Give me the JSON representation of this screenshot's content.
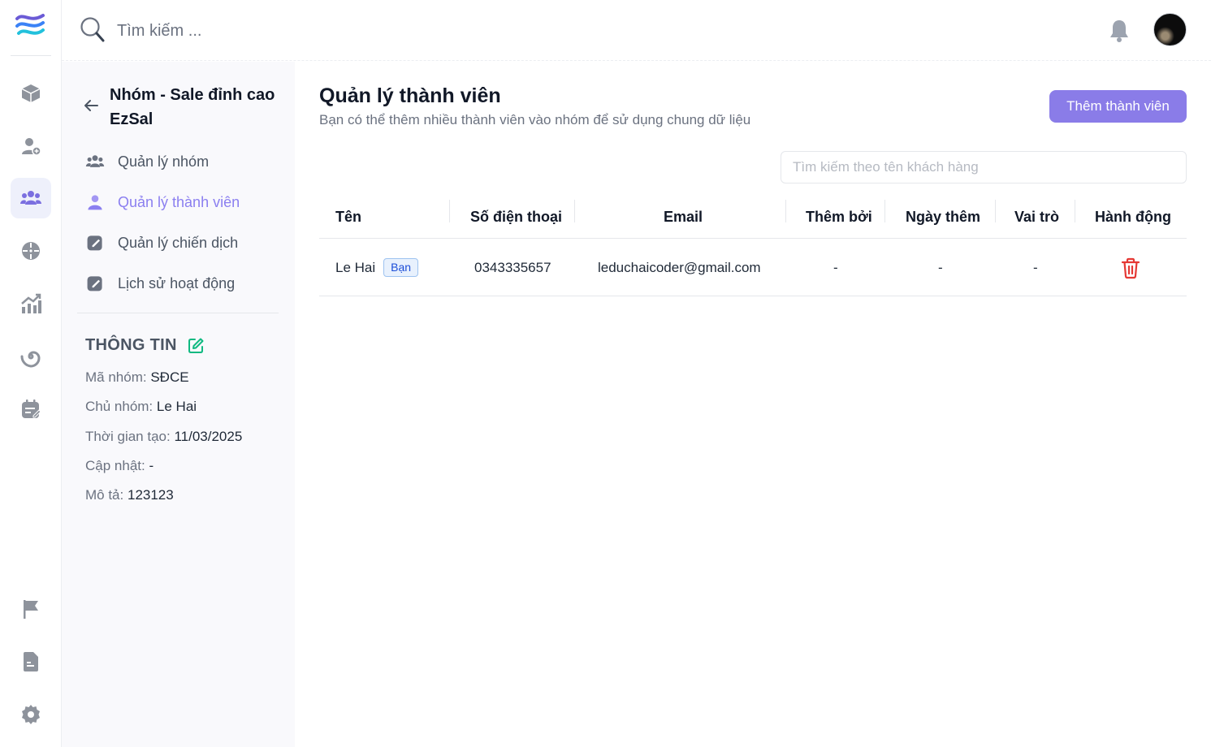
{
  "topbar": {
    "search_placeholder": "Tìm kiếm ..."
  },
  "rail": {
    "items": [
      "cube-icon",
      "user-add-icon",
      "users-icon",
      "crosshair-icon",
      "chart-icon",
      "spiral-icon",
      "calendar-edit-icon",
      "flag-icon",
      "document-icon",
      "gear-icon"
    ],
    "active": "users-icon"
  },
  "subnav": {
    "group_title": "Nhóm - Sale đỉnh cao EzSal",
    "items": [
      {
        "label": "Quản lý nhóm",
        "icon": "users-icon",
        "active": false
      },
      {
        "label": "Quản lý thành viên",
        "icon": "user-icon",
        "active": true
      },
      {
        "label": "Quản lý chiến dịch",
        "icon": "edit-icon",
        "active": false
      },
      {
        "label": "Lịch sử hoạt động",
        "icon": "edit-icon",
        "active": false
      }
    ],
    "info": {
      "title": "THÔNG TIN",
      "rows": [
        {
          "label": "Mã nhóm:",
          "value": "SĐCE"
        },
        {
          "label": "Chủ nhóm:",
          "value": "Le Hai"
        },
        {
          "label": "Thời gian tạo:",
          "value": "11/03/2025"
        },
        {
          "label": "Cập nhật:",
          "value": "-"
        },
        {
          "label": "Mô tả:",
          "value": "123123"
        }
      ]
    }
  },
  "main": {
    "title": "Quản lý thành viên",
    "subtitle": "Bạn có thể thêm nhiều thành viên vào nhóm để sử dụng chung dữ liệu",
    "add_button": "Thêm thành viên",
    "filter_placeholder": "Tìm kiếm theo tên khách hàng",
    "table": {
      "columns": [
        "Tên",
        "Số điện thoại",
        "Email",
        "Thêm bởi",
        "Ngày thêm",
        "Vai trò",
        "Hành động"
      ],
      "rows": [
        {
          "name": "Le Hai",
          "badge": "Bạn",
          "phone": "0343335657",
          "email": "leduchaicoder@gmail.com",
          "added_by": "-",
          "added_date": "-",
          "role": "-"
        }
      ]
    }
  },
  "colors": {
    "accent": "#8a7ce8",
    "active_text": "#8b7ff0",
    "danger": "#e53935",
    "edit_green": "#10b981"
  }
}
